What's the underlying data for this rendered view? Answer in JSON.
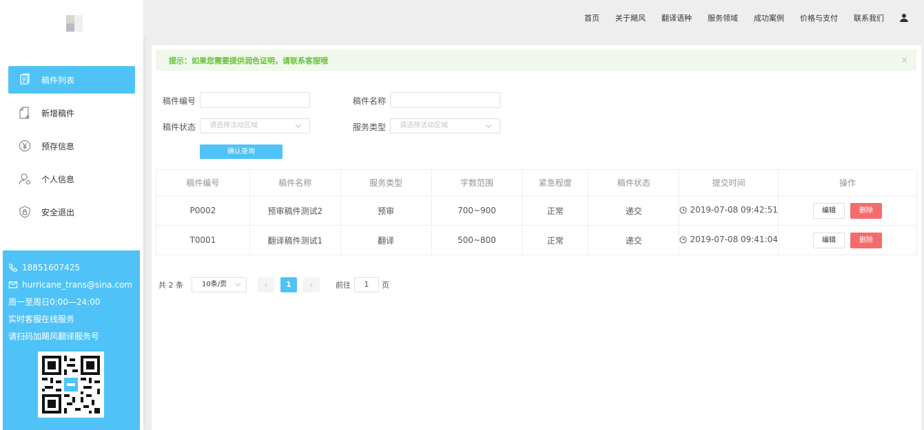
{
  "top_nav": {
    "links": [
      "首页",
      "关于飓风",
      "翻译语种",
      "服务领域",
      "成功案例",
      "价格与支付",
      "联系我们"
    ],
    "user_icon": "user-icon"
  },
  "sidebar": {
    "items": [
      {
        "label": "稿件列表",
        "icon": "document-list-icon",
        "active": true
      },
      {
        "label": "新增稿件",
        "icon": "add-document-icon",
        "active": false
      },
      {
        "label": "预存信息",
        "icon": "yen-icon",
        "active": false
      },
      {
        "label": "个人信息",
        "icon": "user-settings-icon",
        "active": false
      },
      {
        "label": "安全退出",
        "icon": "shield-lock-icon",
        "active": false
      }
    ],
    "contact": {
      "phone": "18851607425",
      "email": "hurricane_trans@sina.com",
      "hours": "周一至周日0:00—24:00",
      "service": "实时客服在线服务",
      "qr_text": "请扫码加飓风翻译服务号"
    },
    "accent_color": "#4fc3f7"
  },
  "alert": {
    "text": "提示：如果您需要提供润色证明，请联系客服哦",
    "close": "×"
  },
  "search": {
    "id_label": "稿件编号",
    "name_label": "稿件名称",
    "status_label": "稿件状态",
    "type_label": "服务类型",
    "status_placeholder": "请选择活动区域",
    "type_placeholder": "请选择活动区域",
    "query_button": "确认查询"
  },
  "table": {
    "headers": [
      "稿件编号",
      "稿件名称",
      "服务类型",
      "字数范围",
      "紧急程度",
      "稿件状态",
      "提交时间",
      "操作"
    ],
    "rows": [
      {
        "id": "P0002",
        "name": "预审稿件测试2",
        "type": "预审",
        "words": "700~900",
        "urgency": "正常",
        "status": "递交",
        "time": "2019-07-08 09:42:51"
      },
      {
        "id": "T0001",
        "name": "翻译稿件测试1",
        "type": "翻译",
        "words": "500~800",
        "urgency": "正常",
        "status": "递交",
        "time": "2019-07-08 09:41:04"
      }
    ],
    "edit_label": "编辑",
    "delete_label": "删除"
  },
  "pagination": {
    "total": "共 2 条",
    "page_size": "10条/页",
    "prev": "‹",
    "current": "1",
    "next": "›",
    "goto_label": "前往",
    "goto_value": "1",
    "page_suffix": "页"
  }
}
